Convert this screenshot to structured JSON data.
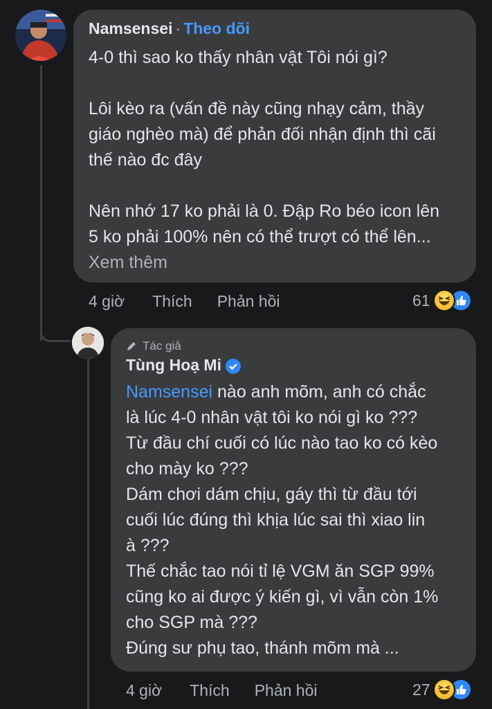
{
  "comment": {
    "author": "Namsensei",
    "separator": "·",
    "follow_label": "Theo dõi",
    "paragraph1": "4-0 thì sao ko thấy nhân vật Tôi nói gì?",
    "paragraph2": "Lôi kèo ra (vấn đề này cũng nhạy cảm, thầy\ngiáo nghèo mà) để phản đối nhận định thì cãi\nthế nào đc đây",
    "paragraph3": "Nên nhớ 17 ko phải là 0. Đập Ro béo icon lên\n5 ko phải 100% nên có thể trượt có thể lên...",
    "see_more": "Xem thêm",
    "time": "4 giờ",
    "like_label": "Thích",
    "reply_label": "Phản hồi",
    "reaction_count": "61",
    "reaction_icons": [
      "haha-icon",
      "like-icon"
    ]
  },
  "reply": {
    "author_tag": "Tác giả",
    "author": "Tùng Hoạ Mi",
    "verified_icon": "verified-badge-icon",
    "mention": "Namsensei",
    "text_after_mention": " nào anh mõm, anh có chắc\nlà lúc 4-0 nhân vật tôi ko nói gì ko ???\nTừ đầu chí cuối có lúc nào tao ko có kèo\ncho mày ko ???\nDám chơi dám chịu, gáy thì từ đầu tới\ncuối lúc đúng thì khịa lúc sai thì xiao lin\nà ???\nThế chắc tao nói tỉ lệ VGM ăn SGP 99%\ncũng ko ai được ý kiến gì, vì vẫn còn 1%\ncho SGP mà ???\nĐúng sư phụ tao, thánh mõm mà ...",
    "time": "4 giờ",
    "like_label": "Thích",
    "reply_label": "Phản hồi",
    "reaction_count": "27",
    "reaction_icons": [
      "haha-icon",
      "like-icon"
    ]
  },
  "colors": {
    "background": "#18191a",
    "bubble": "#3a3b3c",
    "link": "#4599ff",
    "muted": "#b0b3b8"
  }
}
